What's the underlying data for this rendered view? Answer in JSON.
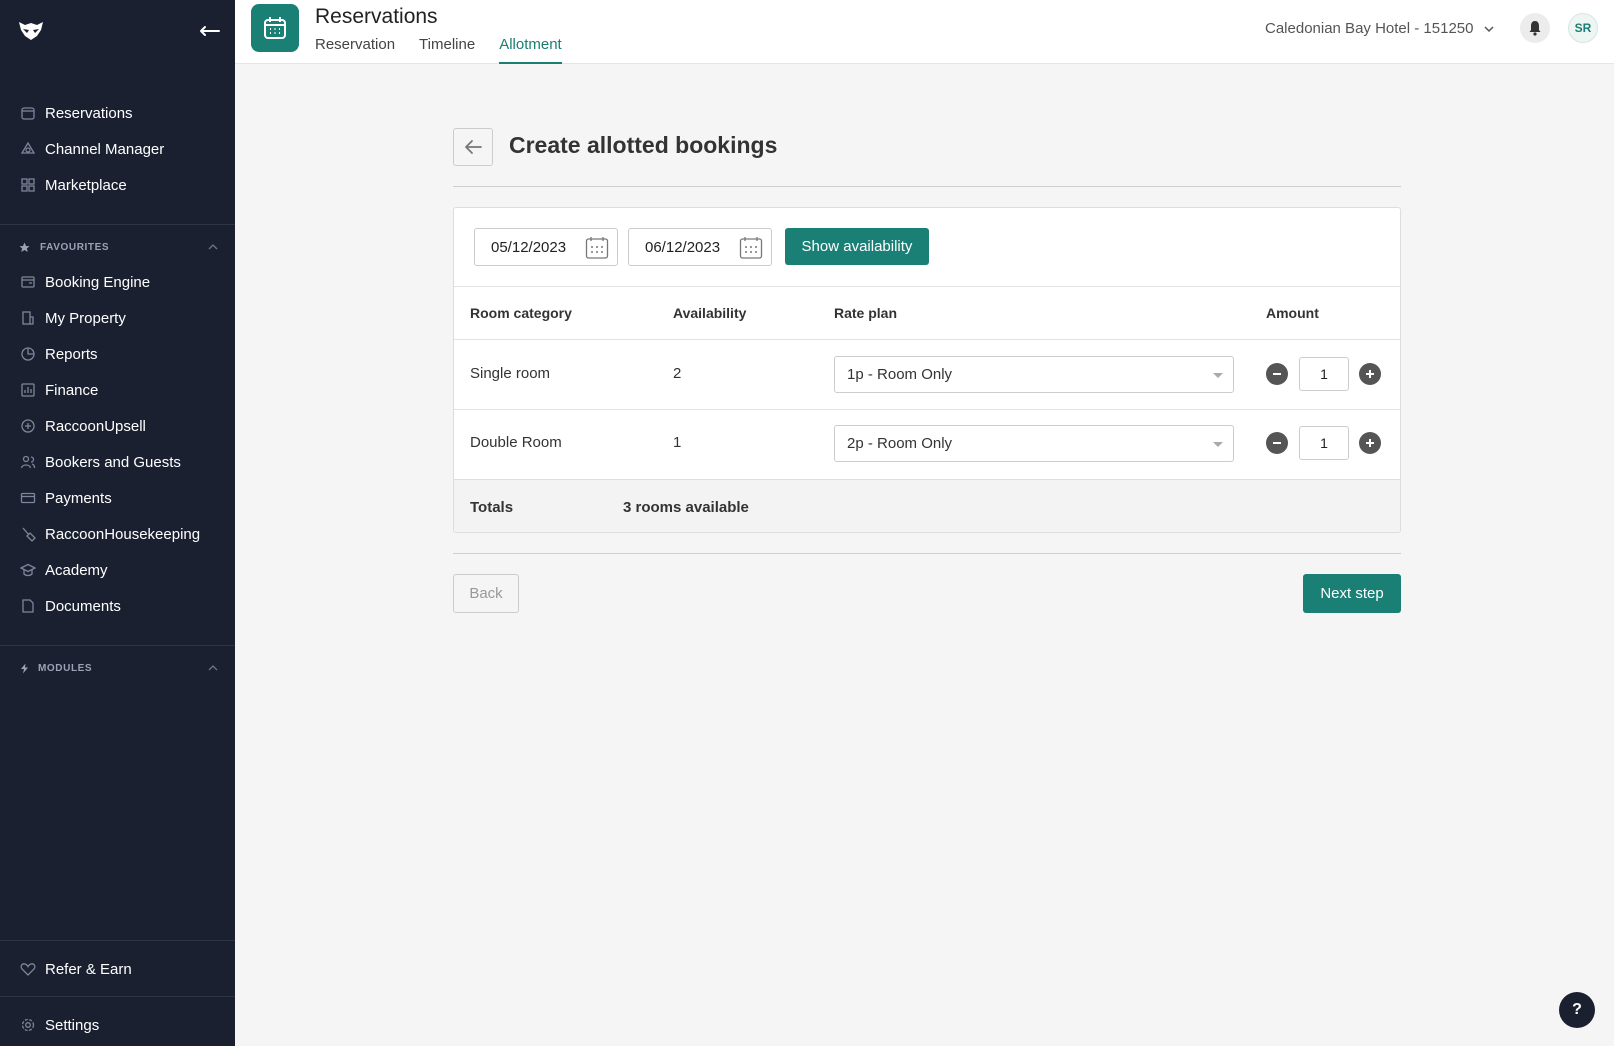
{
  "sidebar": {
    "items": [
      {
        "label": "Reservations",
        "icon": "calendar-icon"
      },
      {
        "label": "Channel Manager",
        "icon": "channel-icon"
      },
      {
        "label": "Marketplace",
        "icon": "grid-icon"
      }
    ],
    "favourites_label": "FAVOURITES",
    "favourites": [
      {
        "label": "Booking Engine",
        "icon": "booking-icon"
      },
      {
        "label": "My Property",
        "icon": "building-icon"
      },
      {
        "label": "Reports",
        "icon": "pie-chart-icon"
      },
      {
        "label": "Finance",
        "icon": "bar-chart-icon"
      },
      {
        "label": "RaccoonUpsell",
        "icon": "plus-circle-icon"
      },
      {
        "label": "Bookers and Guests",
        "icon": "users-icon"
      },
      {
        "label": "Payments",
        "icon": "card-icon"
      },
      {
        "label": "RaccoonHousekeeping",
        "icon": "broom-icon"
      },
      {
        "label": "Academy",
        "icon": "graduation-icon"
      },
      {
        "label": "Documents",
        "icon": "document-icon"
      }
    ],
    "modules_label": "MODULES",
    "refer": "Refer & Earn",
    "settings": "Settings"
  },
  "header": {
    "title": "Reservations",
    "tabs": [
      {
        "label": "Reservation"
      },
      {
        "label": "Timeline"
      },
      {
        "label": "Allotment"
      }
    ],
    "hotel": "Caledonian Bay Hotel - 151250",
    "avatar": "SR"
  },
  "page": {
    "title": "Create allotted bookings",
    "date_from": "05/12/2023",
    "date_to": "06/12/2023",
    "show_availability": "Show availability",
    "columns": [
      "Room category",
      "Availability",
      "Rate plan",
      "Amount"
    ],
    "rows": [
      {
        "category": "Single room",
        "availability": "2",
        "rate_plan": "1p - Room Only",
        "amount": "1"
      },
      {
        "category": "Double Room",
        "availability": "1",
        "rate_plan": "2p - Room Only",
        "amount": "1"
      }
    ],
    "totals_label": "Totals",
    "totals_value": "3 rooms available",
    "back": "Back",
    "next": "Next step"
  },
  "help": "?",
  "colors": {
    "accent": "#1a7f74",
    "sidebar": "#1a2030"
  }
}
